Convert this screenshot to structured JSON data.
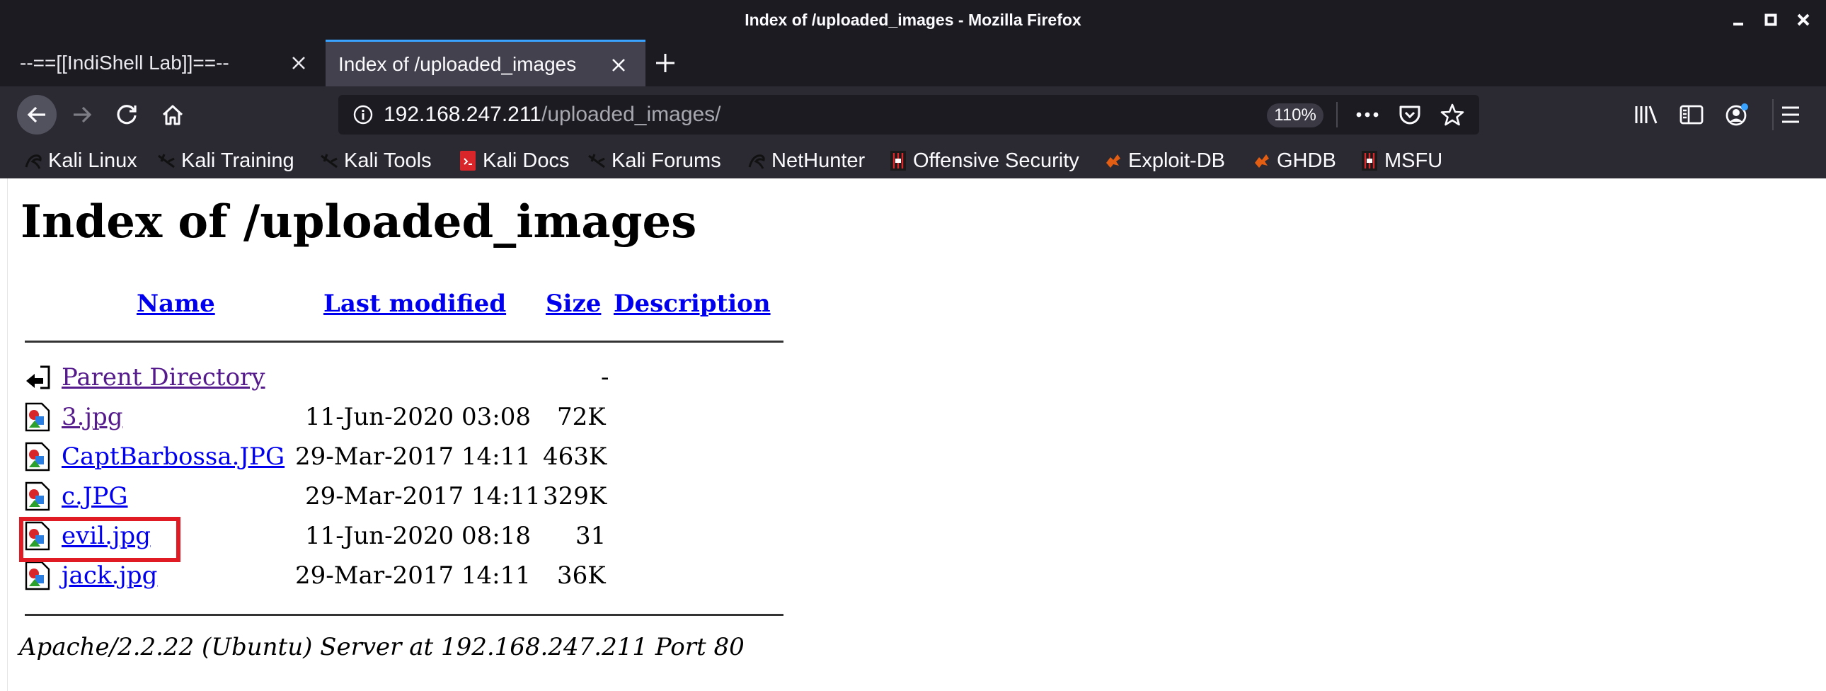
{
  "window": {
    "title": "Index of /uploaded_images - Mozilla Firefox"
  },
  "tabs": [
    {
      "label": "--==[[IndiShell Lab]]==--",
      "active": false
    },
    {
      "label": "Index of /uploaded_images",
      "active": true
    }
  ],
  "urlbar": {
    "host": "192.168.247.211",
    "path": "/uploaded_images/",
    "zoom": "110%"
  },
  "bookmarks": [
    {
      "label": "Kali Linux",
      "icon": "kali-dragon-icon"
    },
    {
      "label": "Kali Training",
      "icon": "kali-dragon-icon"
    },
    {
      "label": "Kali Tools",
      "icon": "kali-dragon-icon"
    },
    {
      "label": "Kali Docs",
      "icon": "kali-docs-icon"
    },
    {
      "label": "Kali Forums",
      "icon": "kali-dragon-icon"
    },
    {
      "label": "NetHunter",
      "icon": "kali-dragon-icon"
    },
    {
      "label": "Offensive Security",
      "icon": "offsec-icon"
    },
    {
      "label": "Exploit-DB",
      "icon": "exploit-db-icon"
    },
    {
      "label": "GHDB",
      "icon": "exploit-db-icon"
    },
    {
      "label": "MSFU",
      "icon": "offsec-icon"
    }
  ],
  "page": {
    "heading": "Index of /uploaded_images",
    "columns": {
      "name": "Name",
      "last_modified": "Last modified",
      "size": "Size",
      "description": "Description"
    },
    "parent": {
      "name": "Parent Directory",
      "size": "-"
    },
    "files": [
      {
        "name": "3.jpg",
        "modified": "11-Jun-2020 03:08",
        "size": "72K",
        "visited": true
      },
      {
        "name": "CaptBarbossa.JPG",
        "modified": "29-Mar-2017 14:11",
        "size": "463K",
        "visited": false
      },
      {
        "name": "c.JPG",
        "modified": "29-Mar-2017 14:11",
        "size": "329K",
        "visited": false
      },
      {
        "name": "evil.jpg",
        "modified": "11-Jun-2020 08:18",
        "size": "31",
        "visited": false,
        "highlighted": true
      },
      {
        "name": "jack.jpg",
        "modified": "29-Mar-2017 14:11",
        "size": "36K",
        "visited": false
      }
    ],
    "server_signature": "Apache/2.2.22 (Ubuntu) Server at 192.168.247.211 Port 80"
  },
  "colors": {
    "link": "#0000ee",
    "visited_link": "#551a8b",
    "highlight": "#e01b24",
    "tab_accent": "#3aa3ff"
  }
}
